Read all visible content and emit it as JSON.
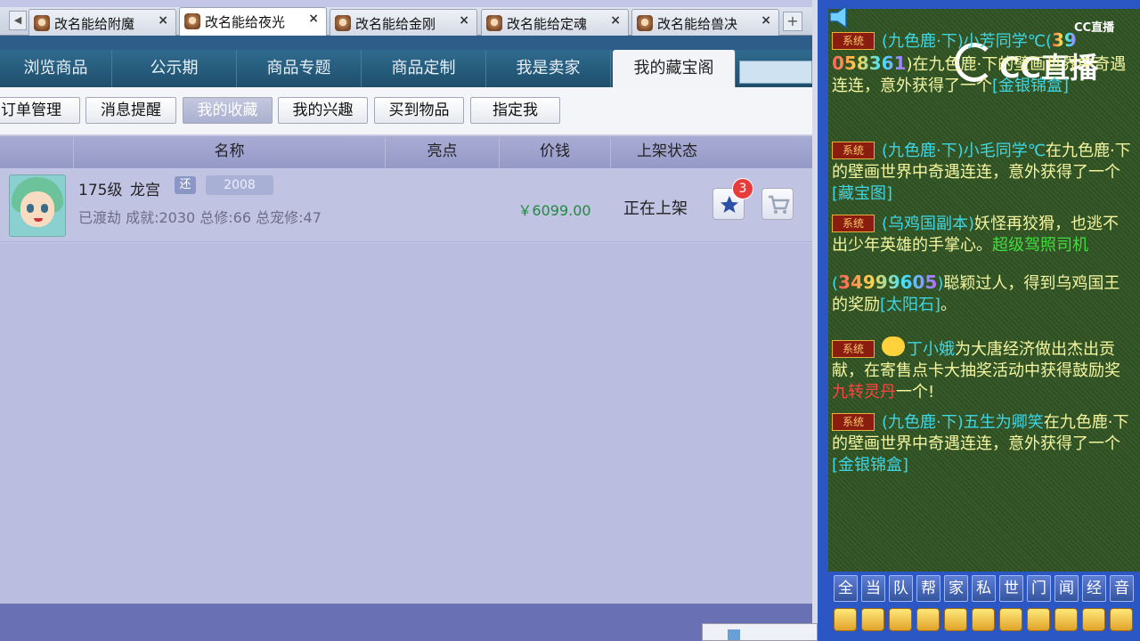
{
  "browser": {
    "tabs": [
      {
        "label": "改名能给附魔",
        "close": "×"
      },
      {
        "label": "改名能给夜光",
        "close": "×"
      },
      {
        "label": "改名能给金刚",
        "close": "×"
      },
      {
        "label": "改名能给定魂",
        "close": "×"
      },
      {
        "label": "改名能给兽决",
        "close": "×"
      }
    ],
    "active_tab": 1,
    "scroll_left": "◀",
    "new_tab": "+"
  },
  "main_nav": {
    "items": [
      "浏览商品",
      "公示期",
      "商品专题",
      "商品定制",
      "我是卖家",
      "我的藏宝阁"
    ],
    "active": "我的藏宝阁"
  },
  "sub_nav": {
    "items": [
      "订单管理",
      "消息提醒",
      "我的收藏",
      "我的兴趣",
      "买到物品",
      "指定我"
    ],
    "active": "我的收藏"
  },
  "table": {
    "headers": [
      "名称",
      "亮点",
      "价钱",
      "上架状态"
    ],
    "rows": [
      {
        "level": "175级",
        "school": "龙宫",
        "tag": "还",
        "id": "2008",
        "detail": "已渡劫 成就:2030 总修:66 总宠修:47",
        "price": "￥6099.00",
        "status": "正在上架",
        "fav_count": "3"
      }
    ]
  },
  "chat": {
    "logo_small": "CC直播",
    "logo_big": "CC直播",
    "sys_tag": "系统",
    "messages": [
      {
        "id": 1,
        "parts": [
          "(九色鹿·下)小芳同学℃(",
          "39",
          "058361",
          ")在九色鹿·下的壁画世界中奇遇连连，意外获得了一个",
          "[金银锦盒]"
        ]
      },
      {
        "id": 2,
        "parts": [
          "(九色鹿·下)小毛同学℃",
          "在九色鹿·下的壁画世界中奇遇连连，意外获得了一个",
          "[藏宝图]"
        ]
      },
      {
        "id": 3,
        "parts": [
          "(乌鸡国副本)",
          "妖怪再狡猾，也逃不出少年英雄的手掌心。",
          "超级驾照司机"
        ]
      },
      {
        "id": 4,
        "parts": [
          "(",
          "34999605",
          ")",
          "聪颖过人，得到乌鸡国王的奖励",
          "[太阳石]",
          "。"
        ]
      },
      {
        "id": 5,
        "parts": [
          "丁小娥",
          "为大唐经济做出杰出贡献，在寄售点卡大抽奖活动中获得鼓励奖",
          "九转灵丹",
          "一个!"
        ]
      },
      {
        "id": 6,
        "parts": [
          "(九色鹿·下)五生为卿笑",
          "在九色鹿·下的壁画世界中奇遇连连，意外获得了一个",
          "[金银锦盒]"
        ]
      }
    ],
    "channels": [
      "全",
      "当",
      "队",
      "帮",
      "家",
      "私",
      "世",
      "门",
      "闻",
      "经",
      "音"
    ]
  },
  "colors": {
    "nav_bg": "#2f6b8f",
    "chat_bg": "#33532a",
    "price": "#1f8b3c",
    "badge": "#e83b3b",
    "right_frame": "#2a57c4"
  }
}
